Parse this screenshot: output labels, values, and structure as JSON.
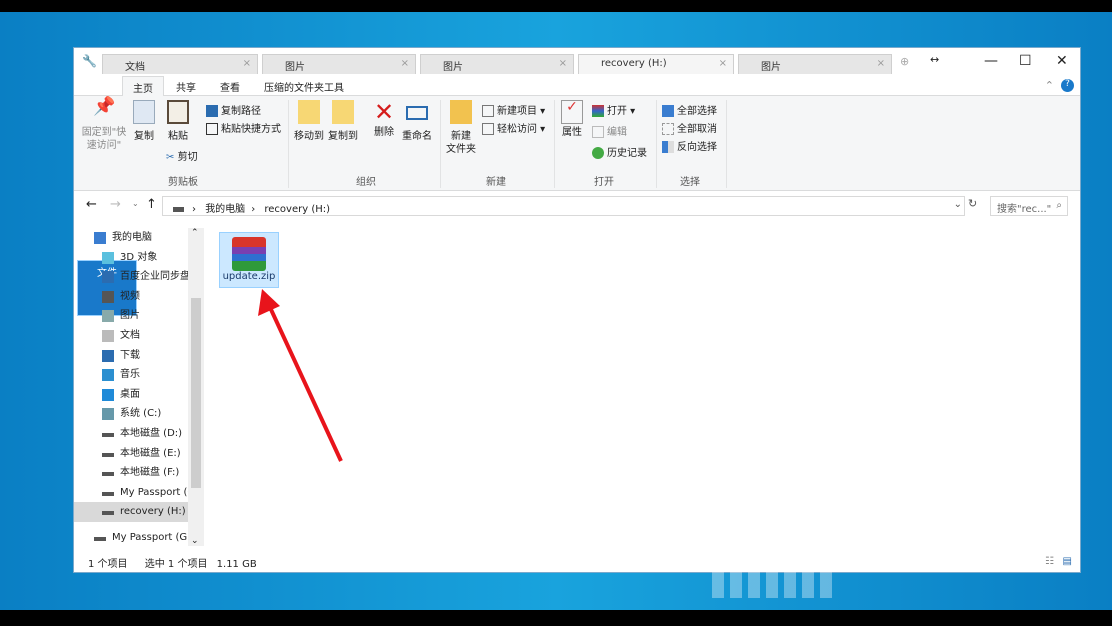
{
  "tabs": [
    {
      "label": "文档",
      "icon": "document-icon"
    },
    {
      "label": "图片",
      "icon": "picture-icon"
    },
    {
      "label": "图片",
      "icon": "picture-icon"
    },
    {
      "label": "recovery (H:)",
      "icon": "drive-icon",
      "active": true
    },
    {
      "label": "图片",
      "icon": "picture-icon"
    }
  ],
  "window_controls": {
    "minimize": "—",
    "maximize": "☐",
    "close": "✕",
    "share": "↔"
  },
  "menu": {
    "file": "文件",
    "home": "主页",
    "share": "共享",
    "view": "查看",
    "zip_tools": "压缩的文件夹工具"
  },
  "ribbon": {
    "pin": "固定到\"快速访问\"",
    "copy": "复制",
    "paste": "粘贴",
    "copy_path": "复制路径",
    "paste_shortcut": "粘贴快捷方式",
    "cut": "剪切",
    "clipboard": "剪贴板",
    "move_to": "移动到",
    "copy_to": "复制到",
    "delete": "删除",
    "rename": "重命名",
    "organize": "组织",
    "new_folder": "新建\n文件夹",
    "new_item": "新建项目 ▾",
    "easy_access": "轻松访问 ▾",
    "new": "新建",
    "properties": "属性",
    "open": "打开 ▾",
    "edit": "编辑",
    "history": "历史记录",
    "open_group": "打开",
    "select_all": "全部选择",
    "select_none": "全部取消",
    "invert": "反向选择",
    "select": "选择"
  },
  "address": {
    "path": [
      "我的电脑",
      "recovery (H:)"
    ],
    "search_placeholder": "搜索\"rec...\""
  },
  "nav": [
    {
      "label": "我的电脑",
      "icon": "computer-icon",
      "indent": 0
    },
    {
      "label": "3D 对象",
      "icon": "3d-objects-icon"
    },
    {
      "label": "百度企业同步盘",
      "icon": "baidu-sync-icon"
    },
    {
      "label": "视频",
      "icon": "video-icon"
    },
    {
      "label": "图片",
      "icon": "picture-icon"
    },
    {
      "label": "文档",
      "icon": "document-icon"
    },
    {
      "label": "下载",
      "icon": "download-icon"
    },
    {
      "label": "音乐",
      "icon": "music-icon"
    },
    {
      "label": "桌面",
      "icon": "desktop-icon"
    },
    {
      "label": "系统 (C:)",
      "icon": "system-drive-icon"
    },
    {
      "label": "本地磁盘 (D:)",
      "icon": "drive-icon"
    },
    {
      "label": "本地磁盘 (E:)",
      "icon": "drive-icon"
    },
    {
      "label": "本地磁盘 (F:)",
      "icon": "drive-icon"
    },
    {
      "label": "My Passport (G:)",
      "icon": "drive-icon"
    },
    {
      "label": "recovery (H:)",
      "icon": "drive-icon",
      "selected": true
    },
    {
      "label": "My Passport (G:)",
      "icon": "drive-icon",
      "indent": 0
    }
  ],
  "files": [
    {
      "name": "update.zip",
      "icon": "winrar-archive-icon",
      "selected": true
    }
  ],
  "status": {
    "count": "1 个项目",
    "selected": "选中 1 个项目",
    "size": "1.11 GB"
  },
  "colors": {
    "accent": "#1979ca",
    "selection": "#cce8ff",
    "arrow": "#e8141b"
  }
}
